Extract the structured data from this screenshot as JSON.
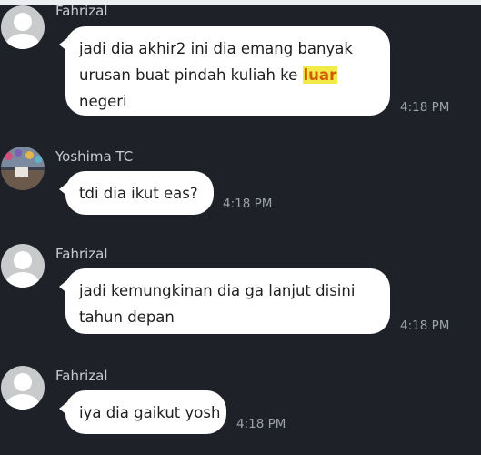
{
  "messages": [
    {
      "sender": "Fahrizal",
      "avatar": "default-user-icon",
      "lines": [
        "jadi dia akhir2 ini dia emang banyak",
        "urusan buat pindah kuliah ke ",
        "luar",
        "negeri"
      ],
      "time": "4:18 PM"
    },
    {
      "sender": "Yoshima TC",
      "avatar": "photo",
      "text": "tdi dia ikut  eas?",
      "time": "4:18 PM"
    },
    {
      "sender": "Fahrizal",
      "avatar": "default-user-icon",
      "lines": [
        "jadi kemungkinan dia ga lanjut disini",
        "tahun depan"
      ],
      "time": "4:18 PM"
    },
    {
      "sender": "Fahrizal",
      "avatar": "default-user-icon",
      "text": "iya dia gaikut yosh",
      "time": "4:18 PM"
    }
  ],
  "colors": {
    "background": "#1f2129",
    "bubble": "#ffffff",
    "highlight_bg": "#f2ea47",
    "highlight_text": "#d25a00",
    "timestamp": "#9ea2ab",
    "sender_name": "#c7cad1"
  }
}
